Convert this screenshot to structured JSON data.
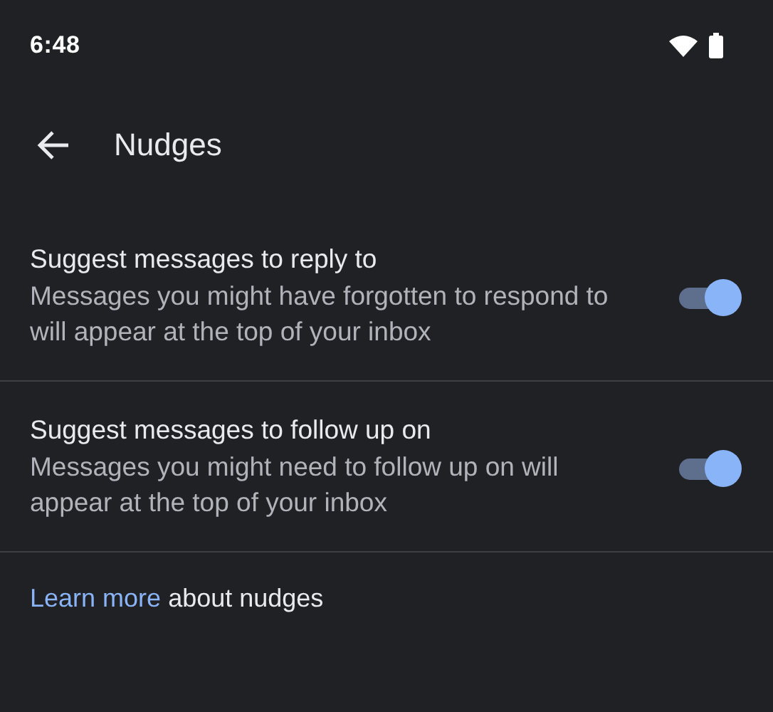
{
  "status_bar": {
    "time": "6:48"
  },
  "header": {
    "title": "Nudges"
  },
  "settings": [
    {
      "title": "Suggest messages to reply to",
      "description": "Messages you might have forgotten to respond to will appear at the top of your inbox",
      "on": true
    },
    {
      "title": "Suggest messages to follow up on",
      "description": "Messages you might need to follow up on will appear at the top of your inbox",
      "on": true
    }
  ],
  "footer": {
    "link": "Learn more",
    "text": "about nudges"
  }
}
